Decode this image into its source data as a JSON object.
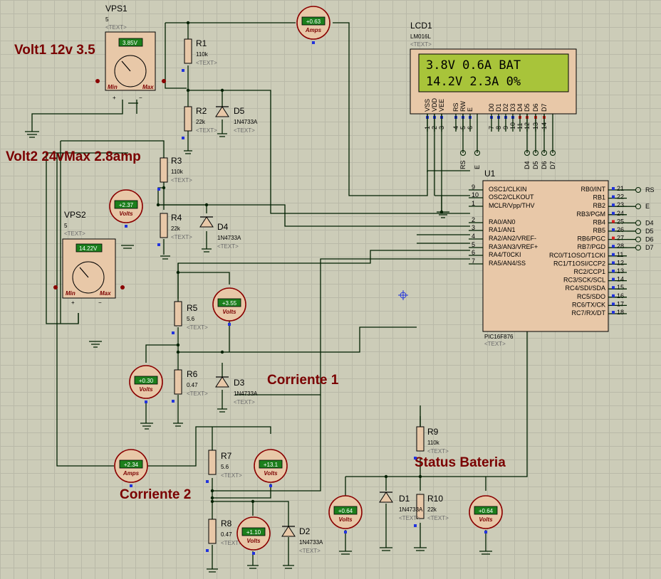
{
  "annotations": {
    "volt1": "Volt1 12v 3.5",
    "volt2": "Volt2 24vMax 2.8amp",
    "corriente1": "Corriente 1",
    "corriente2": "Corriente 2",
    "status_bateria": "Status Bateria"
  },
  "vps1": {
    "name": "VPS1",
    "value": "5",
    "text": "<TEXT>",
    "display": "3.85V",
    "min": "Min",
    "max": "Max"
  },
  "vps2": {
    "name": "VPS2",
    "value": "5",
    "text": "<TEXT>",
    "display": "14.22V",
    "min": "Min",
    "max": "Max"
  },
  "lcd": {
    "name": "LCD1",
    "model": "LM016L",
    "text": "<TEXT>",
    "line1": "3.8V 0.6A BAT",
    "line2": "14.2V 2.3A 0%",
    "pin_names": [
      "VSS",
      "VDD",
      "VEE",
      "RS",
      "RW",
      "E",
      "D0",
      "D1",
      "D2",
      "D3",
      "D4",
      "D5",
      "D6",
      "D7"
    ],
    "pin_numbers": [
      "1",
      "2",
      "3",
      "4",
      "5",
      "6",
      "7",
      "8",
      "9",
      "10",
      "11",
      "12",
      "13",
      "14"
    ],
    "port_labels": [
      "RS",
      "E",
      "D4",
      "D5",
      "D6",
      "D7"
    ]
  },
  "pic": {
    "name": "U1",
    "model": "PIC16F876",
    "text": "<TEXT>",
    "left_pins": [
      {
        "num": "9",
        "label": "OSC1/CLKIN"
      },
      {
        "num": "10",
        "label": "OSC2/CLKOUT"
      },
      {
        "num": "1",
        "label": "MCLR/Vpp/THV"
      },
      {
        "num": "2",
        "label": "RA0/AN0"
      },
      {
        "num": "3",
        "label": "RA1/AN1"
      },
      {
        "num": "4",
        "label": "RA2/AN2/VREF-"
      },
      {
        "num": "5",
        "label": "RA3/AN3/VREF+"
      },
      {
        "num": "6",
        "label": "RA4/T0CKI"
      },
      {
        "num": "7",
        "label": "RA5/AN4/SS"
      }
    ],
    "right_pins": [
      {
        "num": "21",
        "label": "RB0/INT",
        "net": "RS"
      },
      {
        "num": "22",
        "label": "RB1",
        "net": ""
      },
      {
        "num": "23",
        "label": "RB2",
        "net": "E"
      },
      {
        "num": "24",
        "label": "RB3/PGM",
        "net": ""
      },
      {
        "num": "25",
        "label": "RB4",
        "net": "D4"
      },
      {
        "num": "26",
        "label": "RB5",
        "net": "D5"
      },
      {
        "num": "27",
        "label": "RB6/PGC",
        "net": "D6"
      },
      {
        "num": "28",
        "label": "RB7/PGD",
        "net": "D7"
      },
      {
        "num": "11",
        "label": "RC0/T1OSO/T1CKI",
        "net": ""
      },
      {
        "num": "12",
        "label": "RC1/T1OSI/CCP2",
        "net": ""
      },
      {
        "num": "13",
        "label": "RC2/CCP1",
        "net": ""
      },
      {
        "num": "14",
        "label": "RC3/SCK/SCL",
        "net": ""
      },
      {
        "num": "15",
        "label": "RC4/SDI/SDA",
        "net": ""
      },
      {
        "num": "16",
        "label": "RC5/SDO",
        "net": ""
      },
      {
        "num": "17",
        "label": "RC6/TX/CK",
        "net": ""
      },
      {
        "num": "18",
        "label": "RC7/RX/DT",
        "net": ""
      }
    ]
  },
  "resistors": [
    {
      "id": "R1",
      "value": "110k",
      "text": "<TEXT>"
    },
    {
      "id": "R2",
      "value": "22k",
      "text": "<TEXT>"
    },
    {
      "id": "R3",
      "value": "110k",
      "text": "<TEXT>"
    },
    {
      "id": "R4",
      "value": "22k",
      "text": "<TEXT>"
    },
    {
      "id": "R5",
      "value": "5.6",
      "text": "<TEXT>"
    },
    {
      "id": "R6",
      "value": "0.47",
      "text": "<TEXT>"
    },
    {
      "id": "R7",
      "value": "5.6",
      "text": "<TEXT>"
    },
    {
      "id": "R8",
      "value": "0.47",
      "text": "<TEXT>"
    },
    {
      "id": "R9",
      "value": "110k",
      "text": "<TEXT>"
    },
    {
      "id": "R10",
      "value": "22k",
      "text": "<TEXT>"
    }
  ],
  "diodes": [
    {
      "id": "D5",
      "value": "1N4733A",
      "text": "<TEXT>"
    },
    {
      "id": "D4",
      "value": "1N4733A",
      "text": "<TEXT>"
    },
    {
      "id": "D3",
      "value": "1N4733A",
      "text": "<TEXT>"
    },
    {
      "id": "D2",
      "value": "1N4733A",
      "text": "<TEXT>"
    },
    {
      "id": "D1",
      "value": "1N4733A",
      "text": "<TEXT>"
    }
  ],
  "meters": [
    {
      "display": "+0.63",
      "unit": "Amps"
    },
    {
      "display": "+2.37",
      "unit": "Volts"
    },
    {
      "display": "+3.55",
      "unit": "Volts"
    },
    {
      "display": "+0.30",
      "unit": "Volts"
    },
    {
      "display": "+2.34",
      "unit": "Amps"
    },
    {
      "display": "+13.1",
      "unit": "Volts"
    },
    {
      "display": "+1.10",
      "unit": "Volts"
    },
    {
      "display": "+0.64",
      "unit": "Volts"
    },
    {
      "display": "+0.64",
      "unit": "Volts"
    }
  ],
  "colors": {
    "grid_bg": "#ccccb8",
    "wire": "#002000",
    "annotation": "#7a0000",
    "lcd_screen": "#a8c43a",
    "meter_display": "#1c7f1c"
  }
}
